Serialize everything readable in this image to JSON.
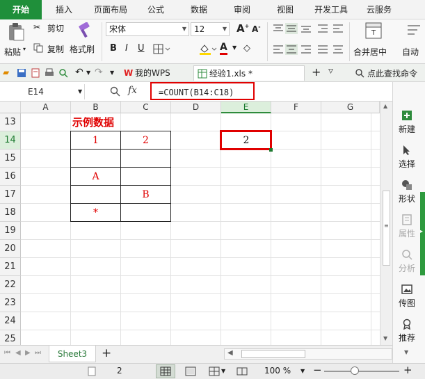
{
  "ribbon_tabs": [
    "开始",
    "插入",
    "页面布局",
    "公式",
    "数据",
    "审阅",
    "视图",
    "开发工具",
    "云服务"
  ],
  "ribbon": {
    "paste_label": "粘贴",
    "cut_label": "剪切",
    "copy_label": "复制",
    "format_painter_label": "格式刷",
    "font_name": "宋体",
    "font_size": "12",
    "bold_label": "B",
    "italic_label": "I",
    "underline_label": "U",
    "increase_font_label": "A",
    "decrease_font_label": "A",
    "font_color_label": "A",
    "merge_center_label": "合并居中",
    "wrap_label": "自动"
  },
  "quickbar": {
    "doc_tabs": [
      {
        "label": "我的WPS"
      },
      {
        "label": "经验1.xls *"
      }
    ],
    "find_command_label": "点此查找命令"
  },
  "formula_bar": {
    "name_box": "E14",
    "fx_label": "fx",
    "formula": "=COUNT(B14:C18)"
  },
  "grid": {
    "columns": [
      "A",
      "B",
      "C",
      "D",
      "E",
      "F",
      "G"
    ],
    "selected_column": "E",
    "rows": [
      "13",
      "14",
      "15",
      "16",
      "17",
      "18",
      "19",
      "20",
      "21",
      "22",
      "23",
      "24",
      "25"
    ],
    "selected_row": "14",
    "title": "示例数据",
    "cells": {
      "B14": "1",
      "C14": "2",
      "B16": "A",
      "C17": "B",
      "B18": "*",
      "E14": "2"
    }
  },
  "side_panel": {
    "items": [
      {
        "label": "新建",
        "icon": "new-icon",
        "enabled": true
      },
      {
        "label": "选择",
        "icon": "select-icon",
        "enabled": true
      },
      {
        "label": "形状",
        "icon": "shape-icon",
        "enabled": true
      },
      {
        "label": "属性",
        "icon": "property-icon",
        "enabled": false
      },
      {
        "label": "分析",
        "icon": "analysis-icon",
        "enabled": false
      },
      {
        "label": "传图",
        "icon": "upload-image-icon",
        "enabled": true
      },
      {
        "label": "推荐",
        "icon": "recommend-icon",
        "enabled": true
      }
    ]
  },
  "sheet_tabs": [
    "Sheet3"
  ],
  "status_bar": {
    "page_number": "2",
    "zoom_label": "100 %"
  },
  "colors": {
    "accent_green": "#1f8f3a",
    "highlight_red": "#e00000"
  }
}
